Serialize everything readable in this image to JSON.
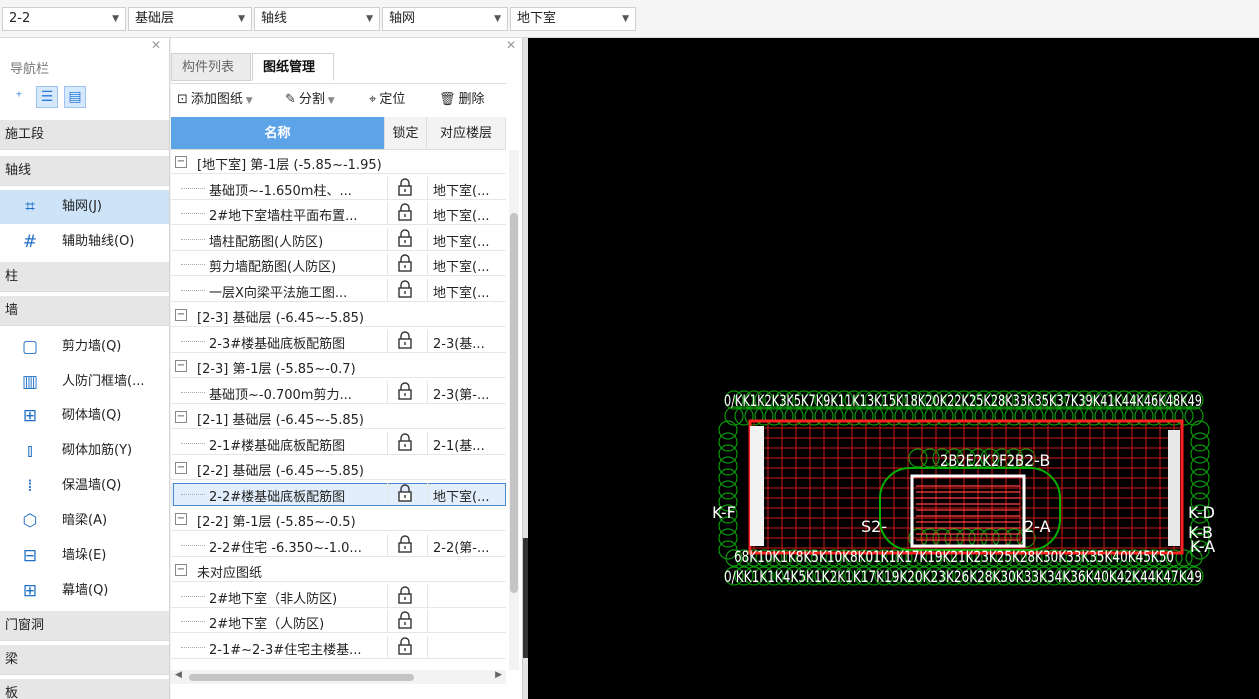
{
  "toolbar": {
    "combos": [
      {
        "value": "2-2"
      },
      {
        "value": "基础层"
      },
      {
        "value": "轴线"
      },
      {
        "value": "轴网"
      },
      {
        "value": "地下室"
      }
    ]
  },
  "nav": {
    "title": "导航栏",
    "categories": {
      "c1": "施工段",
      "c2": "轴线",
      "c3": "柱",
      "c4": "墙",
      "c5": "门窗洞",
      "c6": "梁",
      "c7": "板"
    },
    "items": {
      "grid": "轴网(J)",
      "aux": "辅助轴线(O)",
      "shear": "剪力墙(Q)",
      "civil": "人防门框墙(...",
      "masonry": "砌体墙(Q)",
      "rebar": "砌体加筋(Y)",
      "insul": "保温墙(Q)",
      "hidden": "暗梁(A)",
      "pier": "墙垛(E)",
      "curtain": "幕墙(Q)"
    }
  },
  "panel": {
    "tabs": {
      "list": "构件列表",
      "drawings": "图纸管理"
    },
    "tools": {
      "add": "添加图纸",
      "split": "分割",
      "locate": "定位",
      "delete": "删除"
    },
    "columns": {
      "name": "名称",
      "lock": "锁定",
      "floor": "对应楼层"
    },
    "rows": [
      {
        "type": "group",
        "text": "[地下室] 第-1层 (-5.85~-1.95)"
      },
      {
        "type": "child",
        "text": "基础顶~-1.650m柱、...",
        "floor": "地下室(..."
      },
      {
        "type": "child",
        "text": "2#地下室墙柱平面布置...",
        "floor": "地下室(..."
      },
      {
        "type": "child",
        "text": "墙柱配筋图(人防区)",
        "floor": "地下室(..."
      },
      {
        "type": "child",
        "text": "剪力墙配筋图(人防区)",
        "floor": "地下室(..."
      },
      {
        "type": "child",
        "text": "一层X向梁平法施工图...",
        "floor": "地下室(..."
      },
      {
        "type": "group",
        "text": "[2-3] 基础层 (-6.45~-5.85)"
      },
      {
        "type": "child",
        "text": "2-3#楼基础底板配筋图",
        "floor": "2-3(基..."
      },
      {
        "type": "group",
        "text": "[2-3] 第-1层 (-5.85~-0.7)"
      },
      {
        "type": "child",
        "text": "基础顶~-0.700m剪力...",
        "floor": "2-3(第-..."
      },
      {
        "type": "group",
        "text": "[2-1] 基础层 (-6.45~-5.85)"
      },
      {
        "type": "child",
        "text": "2-1#楼基础底板配筋图",
        "floor": "2-1(基..."
      },
      {
        "type": "group",
        "text": "[2-2] 基础层 (-6.45~-5.85)"
      },
      {
        "type": "child",
        "text": "2-2#楼基础底板配筋图",
        "floor": "地下室(...",
        "selected": true
      },
      {
        "type": "group",
        "text": "[2-2] 第-1层 (-5.85~-0.5)"
      },
      {
        "type": "child",
        "text": "2-2#住宅 -6.350~-1.0...",
        "floor": "2-2(第-..."
      },
      {
        "type": "group",
        "text": "未对应图纸"
      },
      {
        "type": "child",
        "text": "2#地下室（非人防区)",
        "floor": ""
      },
      {
        "type": "child",
        "text": "2#地下室（人防区)",
        "floor": ""
      },
      {
        "type": "child",
        "text": "2-1#~2-3#住宅主楼基...",
        "floor": ""
      }
    ]
  },
  "canvas": {
    "top_label": "0/KK1K2K3K5K7K9K11K13K15K18K20K22K25K28K33K35K37K39K41K44K46K48K49",
    "bottom_label": "0/KK1K1K4K5K1K2K1K17K19K20K23K26K28K30K33K34K36K40K42K44K47K49",
    "row_label": "68K10K1K8K5K10K8K01K1K17K19K21K23K25K28K30K33K35K40K45K50",
    "s2_label": "S2-",
    "a_label": "2-A",
    "b3_label": "2-B",
    "right_a": "K-A",
    "right_d": "K-D",
    "right_b": "K-B",
    "left_f": "K-F",
    "mid_label": "2B2E2K2F2B"
  }
}
